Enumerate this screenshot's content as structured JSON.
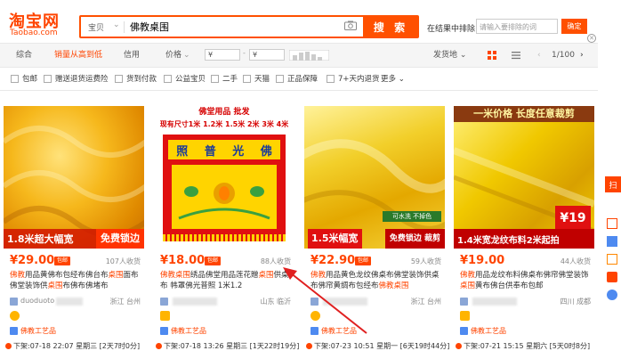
{
  "logo": {
    "main": "淘宝网",
    "sub": "Taobao.com"
  },
  "search": {
    "scope": "宝贝",
    "query": "佛教桌围",
    "button": "搜 索"
  },
  "exclude": {
    "label": "在结果中排除",
    "placeholder": "请输入要排除的词",
    "button": "确定"
  },
  "sort": {
    "items": [
      "综合",
      "销量从高到低",
      "信用",
      "价格"
    ],
    "price_from": "¥",
    "price_to": "¥",
    "fahuo": "发货地",
    "page": "1/100"
  },
  "filters": [
    "包邮",
    "赠送退货运费险",
    "货到付款",
    "公益宝贝",
    "二手",
    "天猫",
    "正品保障",
    "7+天内退货",
    "更多"
  ],
  "products": [
    {
      "banner_left": "1.8米超大幅宽",
      "banner_right": "免费锁边",
      "price": "¥29.00",
      "badge": "包邮",
      "sales": "107人收货",
      "title_parts": [
        [
          "佛教",
          true
        ],
        [
          "用品黄佛布包经布佛台布",
          false
        ],
        [
          "桌围",
          true
        ],
        [
          "面布佛堂装饰供",
          false
        ],
        [
          "桌围",
          true
        ],
        [
          "布佛布佛堵布",
          false
        ]
      ],
      "shop": "duoduoto",
      "location": "浙江 台州",
      "tag": "佛教工艺品",
      "deadline": "下架:07-18 22:07 星期三 [2天7时0分]"
    },
    {
      "img_header": "佛堂用品 批发",
      "img_sizes": "现有尺寸1米 1.2米 1.5米 2米 3米 4米",
      "img_chars": [
        "照",
        "普",
        "光",
        "佛"
      ],
      "price": "¥18.00",
      "badge": "包邮",
      "sales": "88人收货",
      "title_parts": [
        [
          "佛教桌围",
          true
        ],
        [
          "绣品佛堂用品莲花贈",
          false
        ],
        [
          "桌围",
          true
        ],
        [
          "供桌布 帏罩佛光普照 1米1.2",
          false
        ]
      ],
      "shop": "",
      "location": "山东 临沂",
      "tag": "佛教工艺品",
      "deadline": "下架:07-18 13:26 星期三 [1天22时19分]"
    },
    {
      "banner_left": "1.5米幅宽",
      "banner_small": "可水洗 不掉色",
      "banner_right": "免费锁边 裁剪",
      "price": "¥22.90",
      "badge": "包邮",
      "sales": "59人收货",
      "title_parts": [
        [
          "佛教",
          true
        ],
        [
          "用品黄色龙纹佛桌布佛堂装饰供桌布佛帘黄绸布包经布",
          false
        ],
        [
          "佛教桌围",
          true
        ]
      ],
      "shop": "",
      "location": "浙江 台州",
      "tag": "佛教工艺品",
      "deadline": "下架:07-23 10:51 星期一 [6天19时44分]"
    },
    {
      "img_header": "一米价格 长度任意裁剪",
      "banner_left": "1.4米宽龙纹布料2米起拍",
      "price_tag": "¥19",
      "price": "¥19.00",
      "badge": "包邮",
      "sales": "44人收货",
      "title_parts": [
        [
          "佛教",
          true
        ],
        [
          "用品龙纹布料佛桌布佛帘佛堂装饰",
          false
        ],
        [
          "桌围",
          true
        ],
        [
          "黄布佛台供奉布包邮",
          false
        ]
      ],
      "shop": "",
      "location": "四川 成都",
      "tag": "佛教工艺品",
      "deadline": "下架:07-21 15:15 星期六 [5天0时8分]"
    }
  ],
  "rail": {
    "tab": "扫"
  }
}
